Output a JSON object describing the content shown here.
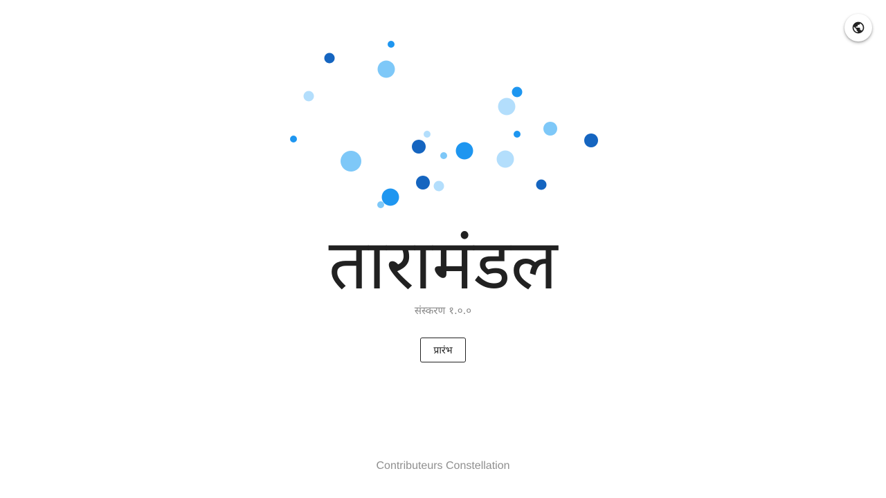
{
  "header": {
    "language_icon": "globe-icon"
  },
  "hero": {
    "title": "तारामंडल",
    "version": "संस्करण १.०.०",
    "start_label": "प्रारंभ"
  },
  "footer": {
    "credits": "Contributeurs Constellation"
  },
  "colors": {
    "dark_blue": "#1565C0",
    "blue": "#1E96F0",
    "light_blue": "#7EC8F8",
    "pale_blue": "#B3DEFC",
    "text": "#212121",
    "muted": "#8a8a8a"
  }
}
